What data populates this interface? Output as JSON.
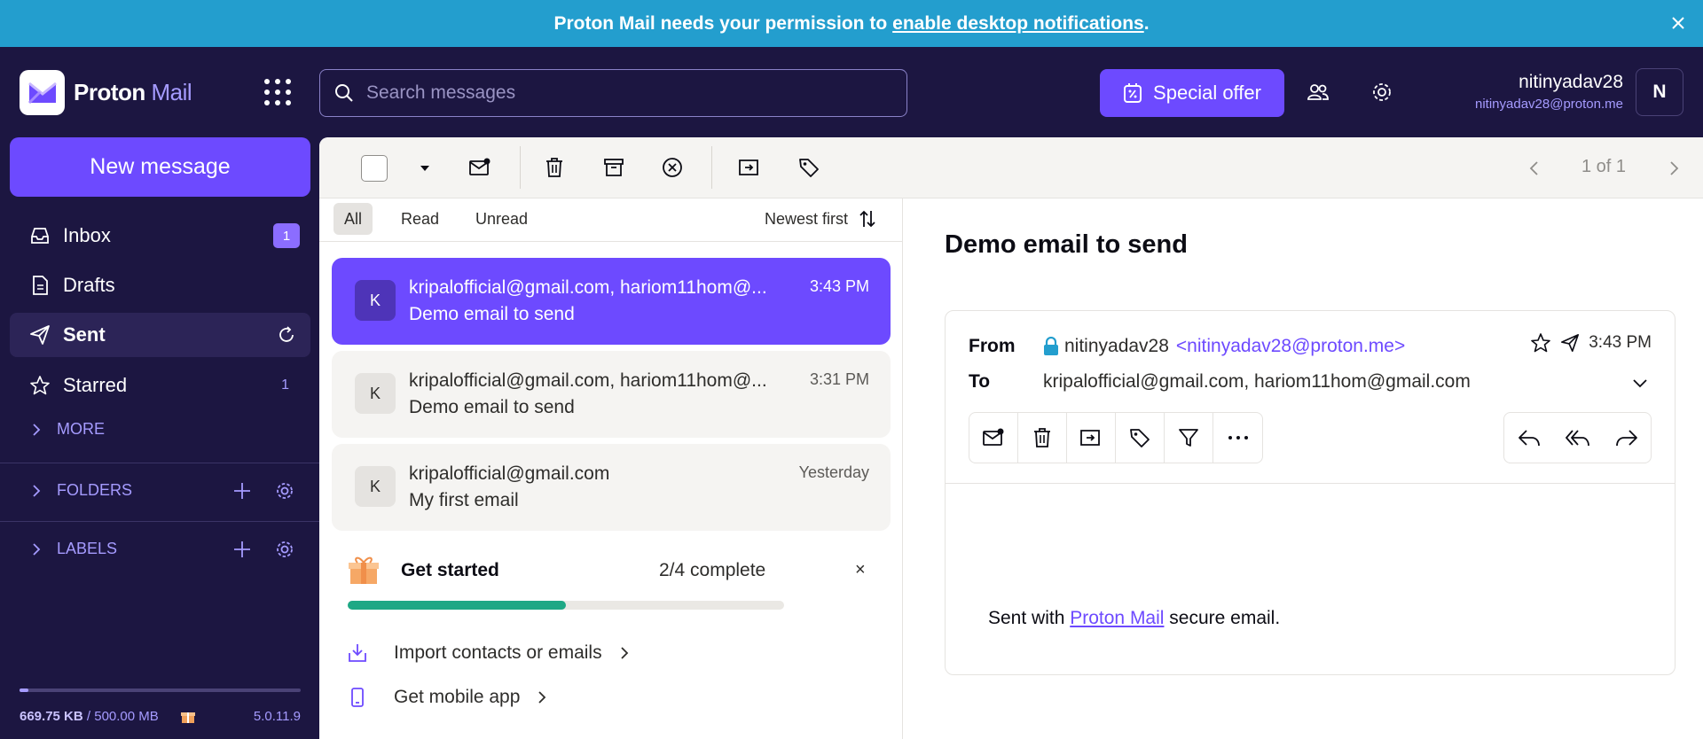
{
  "banner": {
    "text": "Proton Mail needs your permission to",
    "link": "enable desktop notifications",
    "period": "."
  },
  "header": {
    "app_name_bold": "Proton",
    "app_name_light": "Mail",
    "search_placeholder": "Search messages",
    "offer_label": "Special offer",
    "user_name": "nitinyadav28",
    "user_email": "nitinyadav28@proton.me",
    "avatar_initial": "N"
  },
  "sidebar": {
    "new_message": "New message",
    "items": [
      {
        "label": "Inbox",
        "count": "1",
        "icon": "inbox-icon"
      },
      {
        "label": "Drafts",
        "icon": "drafts-icon"
      },
      {
        "label": "Sent",
        "icon": "sent-icon"
      },
      {
        "label": "Starred",
        "count": "1",
        "icon": "star-icon"
      }
    ],
    "more": "MORE",
    "folders": "FOLDERS",
    "labels": "LABELS",
    "storage_used": "669.75 KB",
    "storage_total": "/ 500.00 MB",
    "storage_fraction": 0.0013,
    "version": "5.0.11.9"
  },
  "toolbar": {
    "pager": "1 of 1"
  },
  "filters": {
    "all": "All",
    "read": "Read",
    "unread": "Unread",
    "sort": "Newest first"
  },
  "messages": [
    {
      "initial": "K",
      "from": "kripalofficial@gmail.com, hariom11hom@...",
      "subject": "Demo email to send",
      "time": "3:43 PM"
    },
    {
      "initial": "K",
      "from": "kripalofficial@gmail.com, hariom11hom@...",
      "subject": "Demo email to send",
      "time": "3:31 PM"
    },
    {
      "initial": "K",
      "from": "kripalofficial@gmail.com",
      "subject": "My first email",
      "time": "Yesterday"
    }
  ],
  "get_started": {
    "title": "Get started",
    "progress": "2/4 complete",
    "progress_fraction": 0.5,
    "close": "×",
    "items": [
      "Import contacts or emails",
      "Get mobile app"
    ]
  },
  "reader": {
    "title": "Demo email to send",
    "from_label": "From",
    "from_name": "nitinyadav28",
    "from_addr": "<nitinyadav28@proton.me>",
    "to_label": "To",
    "to_value": "kripalofficial@gmail.com,  hariom11hom@gmail.com",
    "time": "3:43 PM",
    "body_pre": "Sent with",
    "body_link": "Proton Mail",
    "body_post": "secure email."
  },
  "colors": {
    "accent": "#6d4aff",
    "sidebar_bg": "#1c1641",
    "banner_bg": "#239ece",
    "progress_green": "#1ea885"
  }
}
